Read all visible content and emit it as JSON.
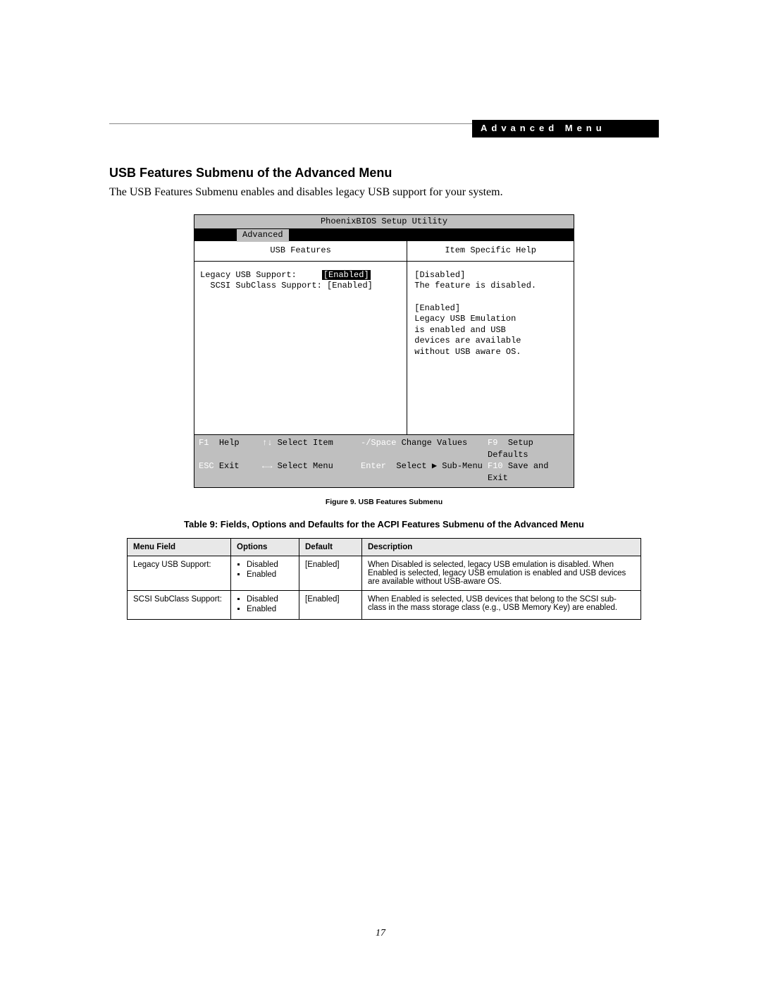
{
  "header": {
    "tab_label": "Advanced Menu"
  },
  "section": {
    "title": "USB Features Submenu of the Advanced Menu",
    "intro": "The USB Features Submenu enables and disables legacy USB support for your system."
  },
  "bios": {
    "utility_title": "PhoenixBIOS Setup Utility",
    "active_tab": "Advanced",
    "left_title": "USB Features",
    "right_title": "Item Specific Help",
    "options": [
      {
        "label": "Legacy USB Support:",
        "value": "[Enabled]",
        "selected": true,
        "indent": 0
      },
      {
        "label": "SCSI SubClass Support:",
        "value": "[Enabled]",
        "selected": false,
        "indent": 1
      }
    ],
    "help_lines": [
      "[Disabled]",
      "The feature is disabled.",
      "",
      "[Enabled]",
      "Legacy USB Emulation",
      "is enabled and USB",
      "devices are available",
      "without USB aware OS."
    ],
    "footer": {
      "r1": {
        "k1": "F1",
        "t1": "Help",
        "k2": "↑↓",
        "t2": "Select Item",
        "k3": "-/Space",
        "t3": "Change Values",
        "k4": "F9",
        "t4": "Setup Defaults"
      },
      "r2": {
        "k1": "ESC",
        "t1": "Exit",
        "k2": "←→",
        "t2": "Select Menu",
        "k3": "Enter",
        "t3": "Select ▶ Sub-Menu",
        "k4": "F10",
        "t4": "Save and Exit"
      }
    }
  },
  "figure_caption": "Figure 9.  USB Features Submenu",
  "table_caption": "Table 9: Fields, Options and Defaults for the ACPI Features Submenu of the Advanced Menu",
  "table": {
    "headers": {
      "menu": "Menu Field",
      "opts": "Options",
      "def": "Default",
      "desc": "Description"
    },
    "rows": [
      {
        "menu": "Legacy USB Support:",
        "opts": [
          "Disabled",
          "Enabled"
        ],
        "def": "[Enabled]",
        "desc": "When Disabled is selected, legacy USB emulation is disabled. When Enabled is selected, legacy USB emulation is enabled and USB devices are available without USB-aware OS."
      },
      {
        "menu": "SCSI SubClass Support:",
        "opts": [
          "Disabled",
          "Enabled"
        ],
        "def": "[Enabled]",
        "desc": "When Enabled is selected, USB devices that belong to the SCSI sub-class in the mass storage class (e.g., USB Memory Key) are enabled."
      }
    ]
  },
  "page_number": "17"
}
